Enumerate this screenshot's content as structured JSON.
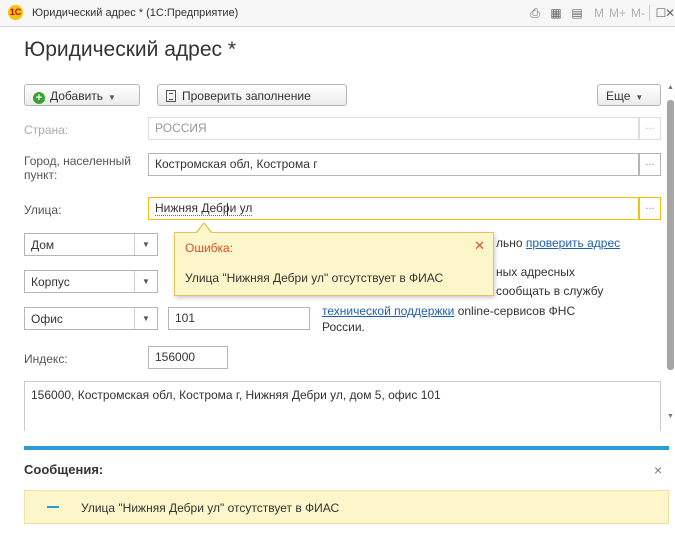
{
  "window": {
    "app_icon_text": "1С",
    "title": "Юридический адрес * (1С:Предприятие)",
    "controls": [
      "M",
      "M+",
      "M-"
    ]
  },
  "page": {
    "title": "Юридический адрес *"
  },
  "toolbar": {
    "add_label": "Добавить",
    "check_label": "Проверить заполнение",
    "more_label": "Еще"
  },
  "form": {
    "country": {
      "label": "Страна:",
      "value": "РОССИЯ"
    },
    "city": {
      "label": "Город, населенный пункт:",
      "value": "Костромская обл, Кострома г"
    },
    "street": {
      "label": "Улица:",
      "value": "Нижняя Дебри ул"
    },
    "house": {
      "type": "Дом"
    },
    "building": {
      "type": "Корпус"
    },
    "office": {
      "type": "Офис",
      "value": "101"
    },
    "index": {
      "label": "Индекс:",
      "value": "156000"
    },
    "hint_partial": "льно",
    "hint_link": "проверить адрес",
    "hint_line2": "ных адресных",
    "hint_line3": "сообщать в службу",
    "hint_link2": "технической  поддержки",
    "hint_line4_rest": " online-сервисов ФНС",
    "hint_line5": "России.",
    "presentation": "156000, Костромская обл, Кострома г, Нижняя Дебри ул, дом 5, офис 101"
  },
  "error_popup": {
    "title": "Ошибка:",
    "text": "Улица \"Нижняя Дебри ул\" отсутствует в ФИАС"
  },
  "messages": {
    "header": "Сообщения:",
    "items": [
      "Улица \"Нижняя Дебри ул\" отсутствует в ФИАС"
    ]
  },
  "colors": {
    "accent": "#2b9bd8",
    "error_bg": "#fdf6cb",
    "error_title": "#d4502a",
    "active_border": "#f3c10b"
  }
}
